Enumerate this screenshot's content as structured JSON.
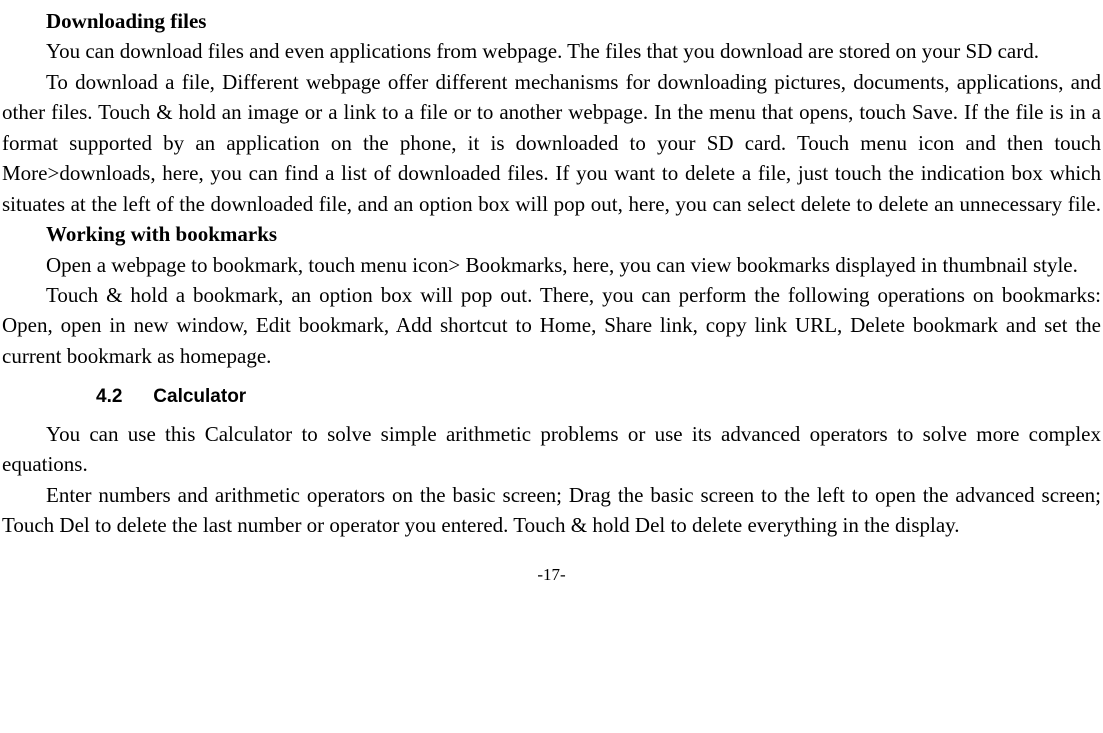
{
  "headings": {
    "downloading": "Downloading files",
    "bookmarks": "Working with bookmarks",
    "section_num": "4.2",
    "section_title": "Calculator"
  },
  "paragraphs": {
    "download_intro": "You can download files and even applications from webpage. The files that you download are stored on your SD card.",
    "download_body": "To download a file, Different webpage offer different mechanisms for downloading pictures, documents, applications, and other files. Touch & hold an image or a link to a file or to another webpage. In the menu that opens, touch Save. If the file is in a format supported by an application on the phone, it is downloaded to your SD card. Touch menu icon and then touch More>downloads, here, you can find a list of downloaded files. If you want to delete a file, just touch the indication box which situates at the left of the downloaded file, and an option box will pop out, here, you can select delete to delete an unnecessary file.",
    "bookmarks_intro": "Open a webpage to bookmark, touch menu icon> Bookmarks, here, you can view bookmarks displayed in thumbnail style.",
    "bookmarks_body": "Touch & hold a bookmark, an option box will pop out. There, you can perform the following operations on bookmarks: Open, open in new window, Edit bookmark, Add shortcut to Home, Share link, copy link URL, Delete bookmark and set the current bookmark as homepage.",
    "calc_intro": "You can use this Calculator to solve simple arithmetic problems or use its advanced operators to solve more complex equations.",
    "calc_body": "Enter numbers and arithmetic operators on the basic screen; Drag the basic screen to the left to open the advanced screen; Touch Del to delete the last number or operator you entered. Touch & hold Del to delete everything in the display."
  },
  "page_number": "-17-"
}
